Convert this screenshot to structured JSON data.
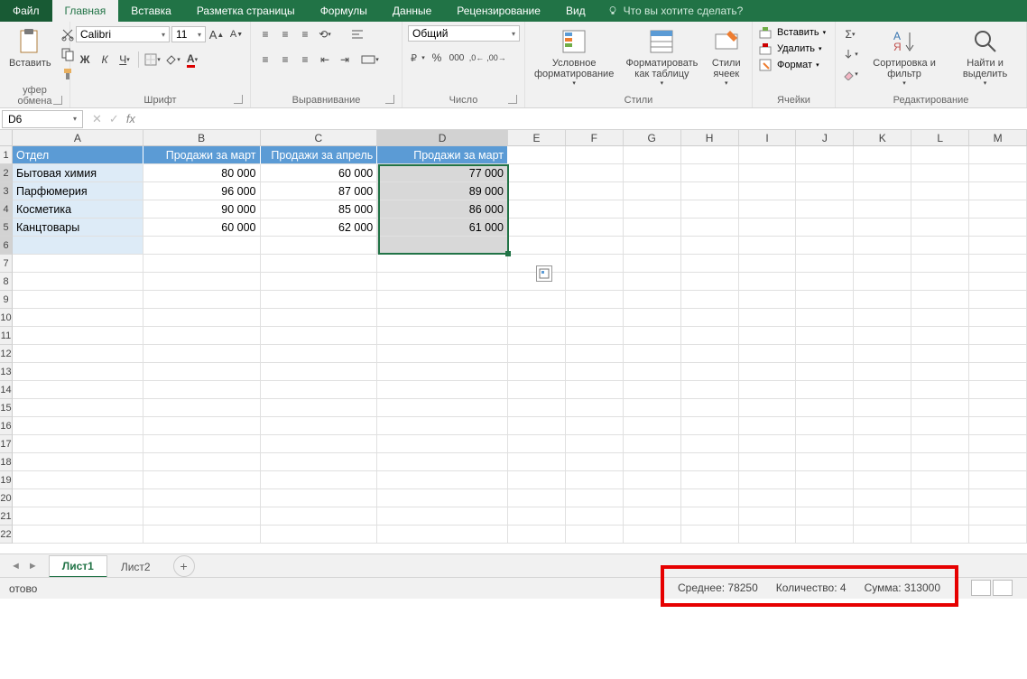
{
  "tabs": {
    "file": "Файл",
    "home": "Главная",
    "insert": "Вставка",
    "page_layout": "Разметка страницы",
    "formulas": "Формулы",
    "data": "Данные",
    "review": "Рецензирование",
    "view": "Вид",
    "tell_me": "Что вы хотите сделать?"
  },
  "ribbon": {
    "clipboard": {
      "paste": "Вставить",
      "label": "уфер обмена"
    },
    "font": {
      "name": "Calibri",
      "size": "11",
      "label": "Шрифт"
    },
    "alignment": {
      "label": "Выравнивание"
    },
    "number": {
      "format": "Общий",
      "label": "Число"
    },
    "styles": {
      "cond": "Условное форматирование",
      "table": "Форматировать как таблицу",
      "cell": "Стили ячеек",
      "label": "Стили"
    },
    "cells": {
      "insert": "Вставить",
      "delete": "Удалить",
      "format": "Формат",
      "label": "Ячейки"
    },
    "editing": {
      "sort": "Сортировка и фильтр",
      "find": "Найти и выделить",
      "label": "Редактирование"
    }
  },
  "formula_bar": {
    "name_box": "D6",
    "fx": "fx"
  },
  "columns": [
    "A",
    "B",
    "C",
    "D",
    "E",
    "F",
    "G",
    "H",
    "I",
    "J",
    "K",
    "L",
    "M"
  ],
  "row_nums": [
    "1",
    "2",
    "3",
    "4",
    "5",
    "6",
    "7",
    "8",
    "9",
    "10",
    "11",
    "12",
    "13",
    "14",
    "15",
    "16",
    "17",
    "18",
    "19",
    "20",
    "21",
    "22"
  ],
  "table": {
    "headers": [
      "Отдел",
      "Продажи за март",
      "Продажи за апрель",
      "Продажи за март"
    ],
    "rows": [
      {
        "label": "Бытовая химия",
        "b": "80 000",
        "c": "60 000",
        "d": "77 000"
      },
      {
        "label": "Парфюмерия",
        "b": "96 000",
        "c": "87 000",
        "d": "89 000"
      },
      {
        "label": "Косметика",
        "b": "90 000",
        "c": "85 000",
        "d": "86 000"
      },
      {
        "label": "Канцтовары",
        "b": "60 000",
        "c": "62 000",
        "d": "61 000"
      }
    ]
  },
  "sheets": {
    "s1": "Лист1",
    "s2": "Лист2"
  },
  "status": {
    "ready": "отово",
    "avg": "Среднее: 78250",
    "count": "Количество: 4",
    "sum": "Сумма: 313000"
  }
}
